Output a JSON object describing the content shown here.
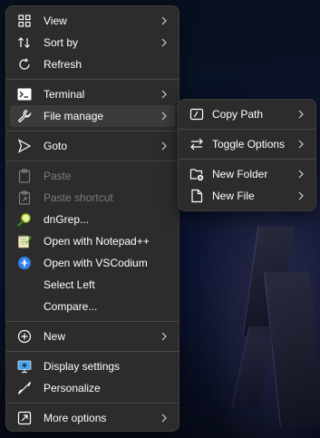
{
  "main_menu": {
    "view": "View",
    "sort_by": "Sort by",
    "refresh": "Refresh",
    "terminal": "Terminal",
    "file_manage": "File manage",
    "goto": "Goto",
    "paste": "Paste",
    "paste_shortcut": "Paste shortcut",
    "dngrep": "dnGrep...",
    "open_notepadpp": "Open with Notepad++",
    "open_vscodium": "Open with VSCodium",
    "select_left": "Select Left",
    "compare": "Compare...",
    "new": "New",
    "display_settings": "Display settings",
    "personalize": "Personalize",
    "more_options": "More options"
  },
  "submenu": {
    "copy_path": "Copy Path",
    "toggle_options": "Toggle Options",
    "new_folder": "New Folder",
    "new_file": "New File"
  },
  "colors": {
    "menu_bg": "#2c2c2c",
    "hover_bg": "#3b3b3b",
    "disabled_text": "#7c7c7c",
    "vscodium_blue": "#2f80ed"
  },
  "icons": {
    "view": "grid-icon",
    "sort_by": "sort-arrows-icon",
    "refresh": "refresh-icon",
    "terminal": "terminal-icon",
    "file_manage": "wrench-icon",
    "goto": "cursor-arrow-icon",
    "paste": "clipboard-icon",
    "paste_shortcut": "clipboard-shortcut-icon",
    "dngrep": "magnifier-icon",
    "notepadpp": "notepad-plus-plus-icon",
    "vscodium": "vscodium-icon",
    "new": "plus-circle-icon",
    "display_settings": "monitor-icon",
    "personalize": "brush-icon",
    "more_options": "expand-icon",
    "copy_path": "copy-path-icon",
    "toggle_options": "swap-arrows-icon",
    "new_folder": "new-folder-icon",
    "new_file": "new-file-icon",
    "chevron": "chevron-right-icon"
  }
}
